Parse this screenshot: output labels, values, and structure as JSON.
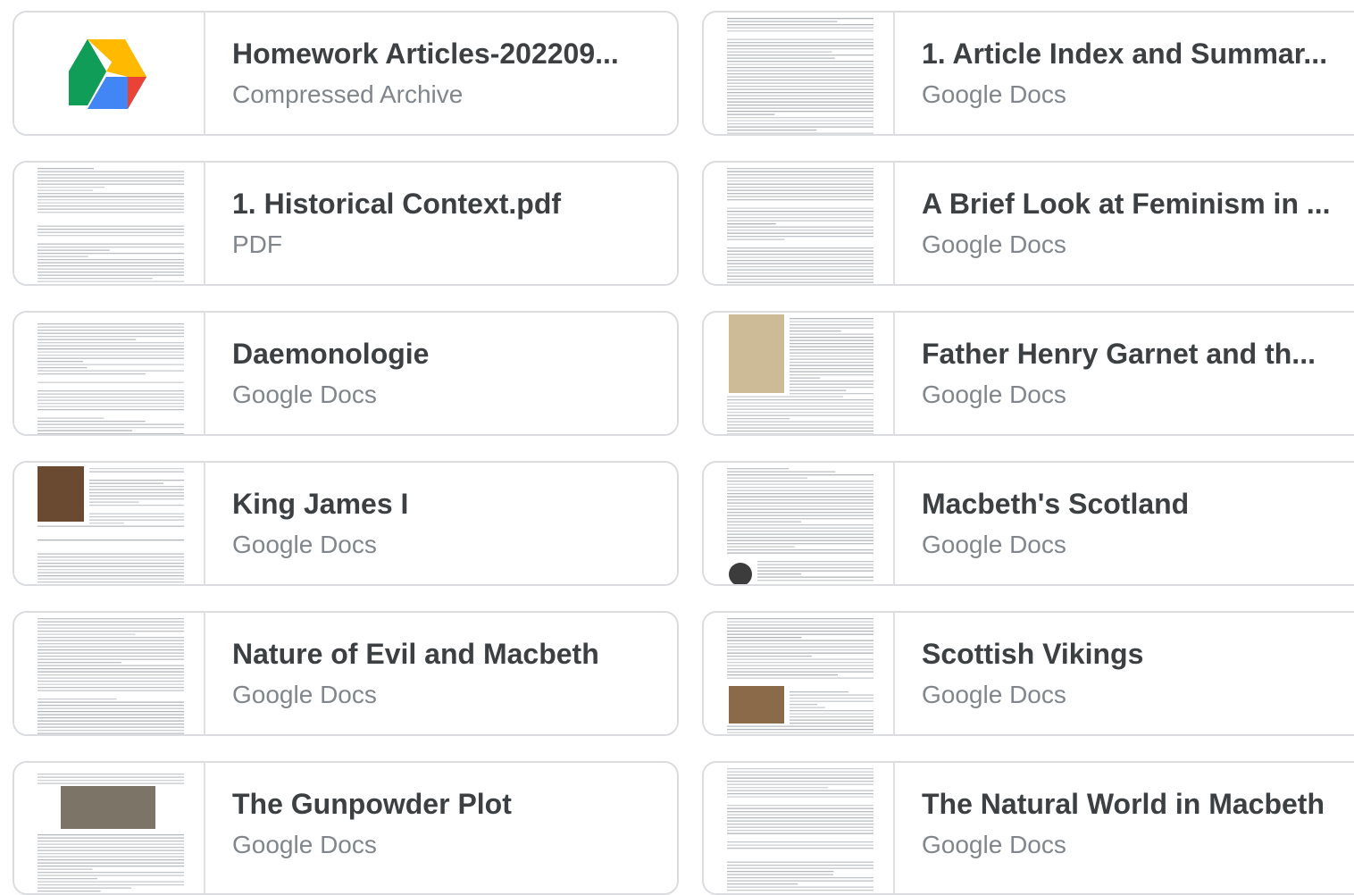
{
  "files": [
    {
      "title": "Homework Articles-202209...",
      "type": "Compressed Archive",
      "thumb_icon": "google-drive-icon"
    },
    {
      "title": "1. Article Index and Summar...",
      "type": "Google Docs",
      "thumb_icon": "document-preview"
    },
    {
      "title": "1. Historical Context.pdf",
      "type": "PDF",
      "thumb_icon": "document-preview"
    },
    {
      "title": "A Brief Look at Feminism in ...",
      "type": "Google Docs",
      "thumb_icon": "document-preview"
    },
    {
      "title": "Daemonologie",
      "type": "Google Docs",
      "thumb_icon": "document-preview"
    },
    {
      "title": "Father Henry Garnet and th...",
      "type": "Google Docs",
      "thumb_icon": "document-preview-with-image"
    },
    {
      "title": "King James I",
      "type": "Google Docs",
      "thumb_icon": "document-preview-with-portrait"
    },
    {
      "title": "Macbeth's Scotland",
      "type": "Google Docs",
      "thumb_icon": "document-preview"
    },
    {
      "title": "Nature of Evil and Macbeth",
      "type": "Google Docs",
      "thumb_icon": "document-preview"
    },
    {
      "title": "Scottish Vikings",
      "type": "Google Docs",
      "thumb_icon": "document-preview-with-image"
    },
    {
      "title": "The Gunpowder Plot",
      "type": "Google Docs",
      "thumb_icon": "document-preview-with-engraving"
    },
    {
      "title": "The Natural World in Macbeth",
      "type": "Google Docs",
      "thumb_icon": "document-preview"
    }
  ],
  "colors": {
    "card_border": "#dadce0",
    "title_text": "#3c4043",
    "subtitle_text": "#80868b",
    "drive_green": "#1fa463",
    "drive_yellow": "#ffd04b",
    "drive_blue": "#4688f4",
    "drive_red": "#db4437"
  }
}
